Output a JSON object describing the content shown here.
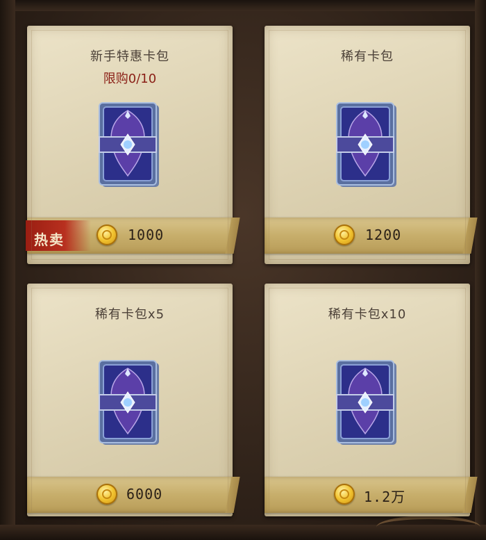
{
  "shop": {
    "packs": [
      {
        "title": "新手特惠卡包",
        "limit": "限购0/10",
        "badge": "热卖",
        "price": "1000",
        "currency_icon": "gold-coin-icon"
      },
      {
        "title": "稀有卡包",
        "price": "1200",
        "currency_icon": "gold-coin-icon"
      },
      {
        "title": "稀有卡包x5",
        "price": "6000",
        "currency_icon": "gold-coin-icon"
      },
      {
        "title": "稀有卡包x10",
        "price": "1.2万",
        "currency_icon": "gold-coin-icon"
      }
    ]
  },
  "colors": {
    "parchment": "#e3d8bb",
    "limit_text": "#8a1f16",
    "hot_badge": "#b8301f",
    "card_back": "#3b3f9a"
  }
}
